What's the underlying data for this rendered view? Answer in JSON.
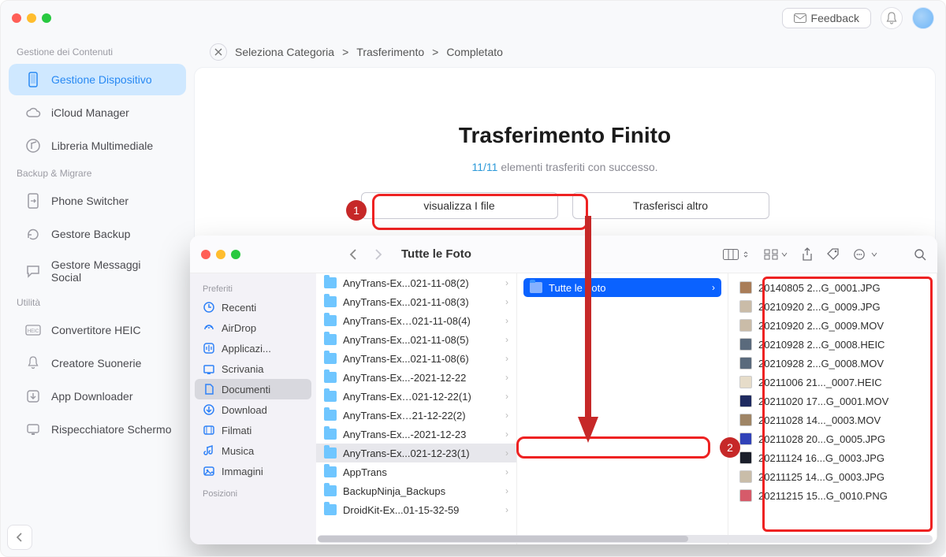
{
  "titlebar": {
    "feedback": "Feedback"
  },
  "sidebar": {
    "sections": [
      {
        "title": "Gestione dei Contenuti",
        "items": [
          "Gestione Dispositivo",
          "iCloud Manager",
          "Libreria Multimediale"
        ]
      },
      {
        "title": "Backup & Migrare",
        "items": [
          "Phone Switcher",
          "Gestore Backup",
          "Gestore Messaggi Social"
        ]
      },
      {
        "title": "Utilità",
        "items": [
          "Convertitore HEIC",
          "Creatore Suonerie",
          "App Downloader",
          "Rispecchiatore Schermo"
        ]
      }
    ]
  },
  "breadcrumb": [
    "Seleziona Categoria",
    ">",
    "Trasferimento",
    ">",
    "Completato"
  ],
  "main": {
    "title": "Trasferimento Finito",
    "progress": "11/11",
    "sub_suffix": " elementi trasferiti con successo.",
    "btn_view": "visualizza I file",
    "btn_more": "Trasferisci altro"
  },
  "annotations": {
    "badge1": "1",
    "badge2": "2"
  },
  "finder": {
    "title": "Tutte le Foto",
    "sidebar_heading": "Preferiti",
    "sidebar_heading2": "Posizioni",
    "sidebar": [
      "Recenti",
      "AirDrop",
      "Applicazi...",
      "Scrivania",
      "Documenti",
      "Download",
      "Filmati",
      "Musica",
      "Immagini"
    ],
    "col1": [
      "AnyTrans-Ex...021-11-08(2)",
      "AnyTrans-Ex...021-11-08(3)",
      "AnyTrans-Ex…021-11-08(4)",
      "AnyTrans-Ex...021-11-08(5)",
      "AnyTrans-Ex...021-11-08(6)",
      "AnyTrans-Ex...-2021-12-22",
      "AnyTrans-Ex…021-12-22(1)",
      "AnyTrans-Ex…21-12-22(2)",
      "AnyTrans-Ex...-2021-12-23",
      "AnyTrans-Ex...021-12-23(1)",
      "AppTrans",
      "BackupNinja_Backups",
      "DroidKit-Ex...01-15-32-59"
    ],
    "col1_selected_index": 9,
    "col2_selected": "Tutte le Foto",
    "col3": [
      "20140805 2...G_0001.JPG",
      "20210920 2...G_0009.JPG",
      "20210920 2...G_0009.MOV",
      "20210928 2...G_0008.HEIC",
      "20210928 2...G_0008.MOV",
      "20211006 21..._0007.HEIC",
      "20211020 17...G_0001.MOV",
      "20211028 14..._0003.MOV",
      "20211028 20...G_0005.JPG",
      "20211124 16...G_0003.JPG",
      "20211125 14...G_0003.JPG",
      "20211215 15...G_0010.PNG"
    ]
  }
}
